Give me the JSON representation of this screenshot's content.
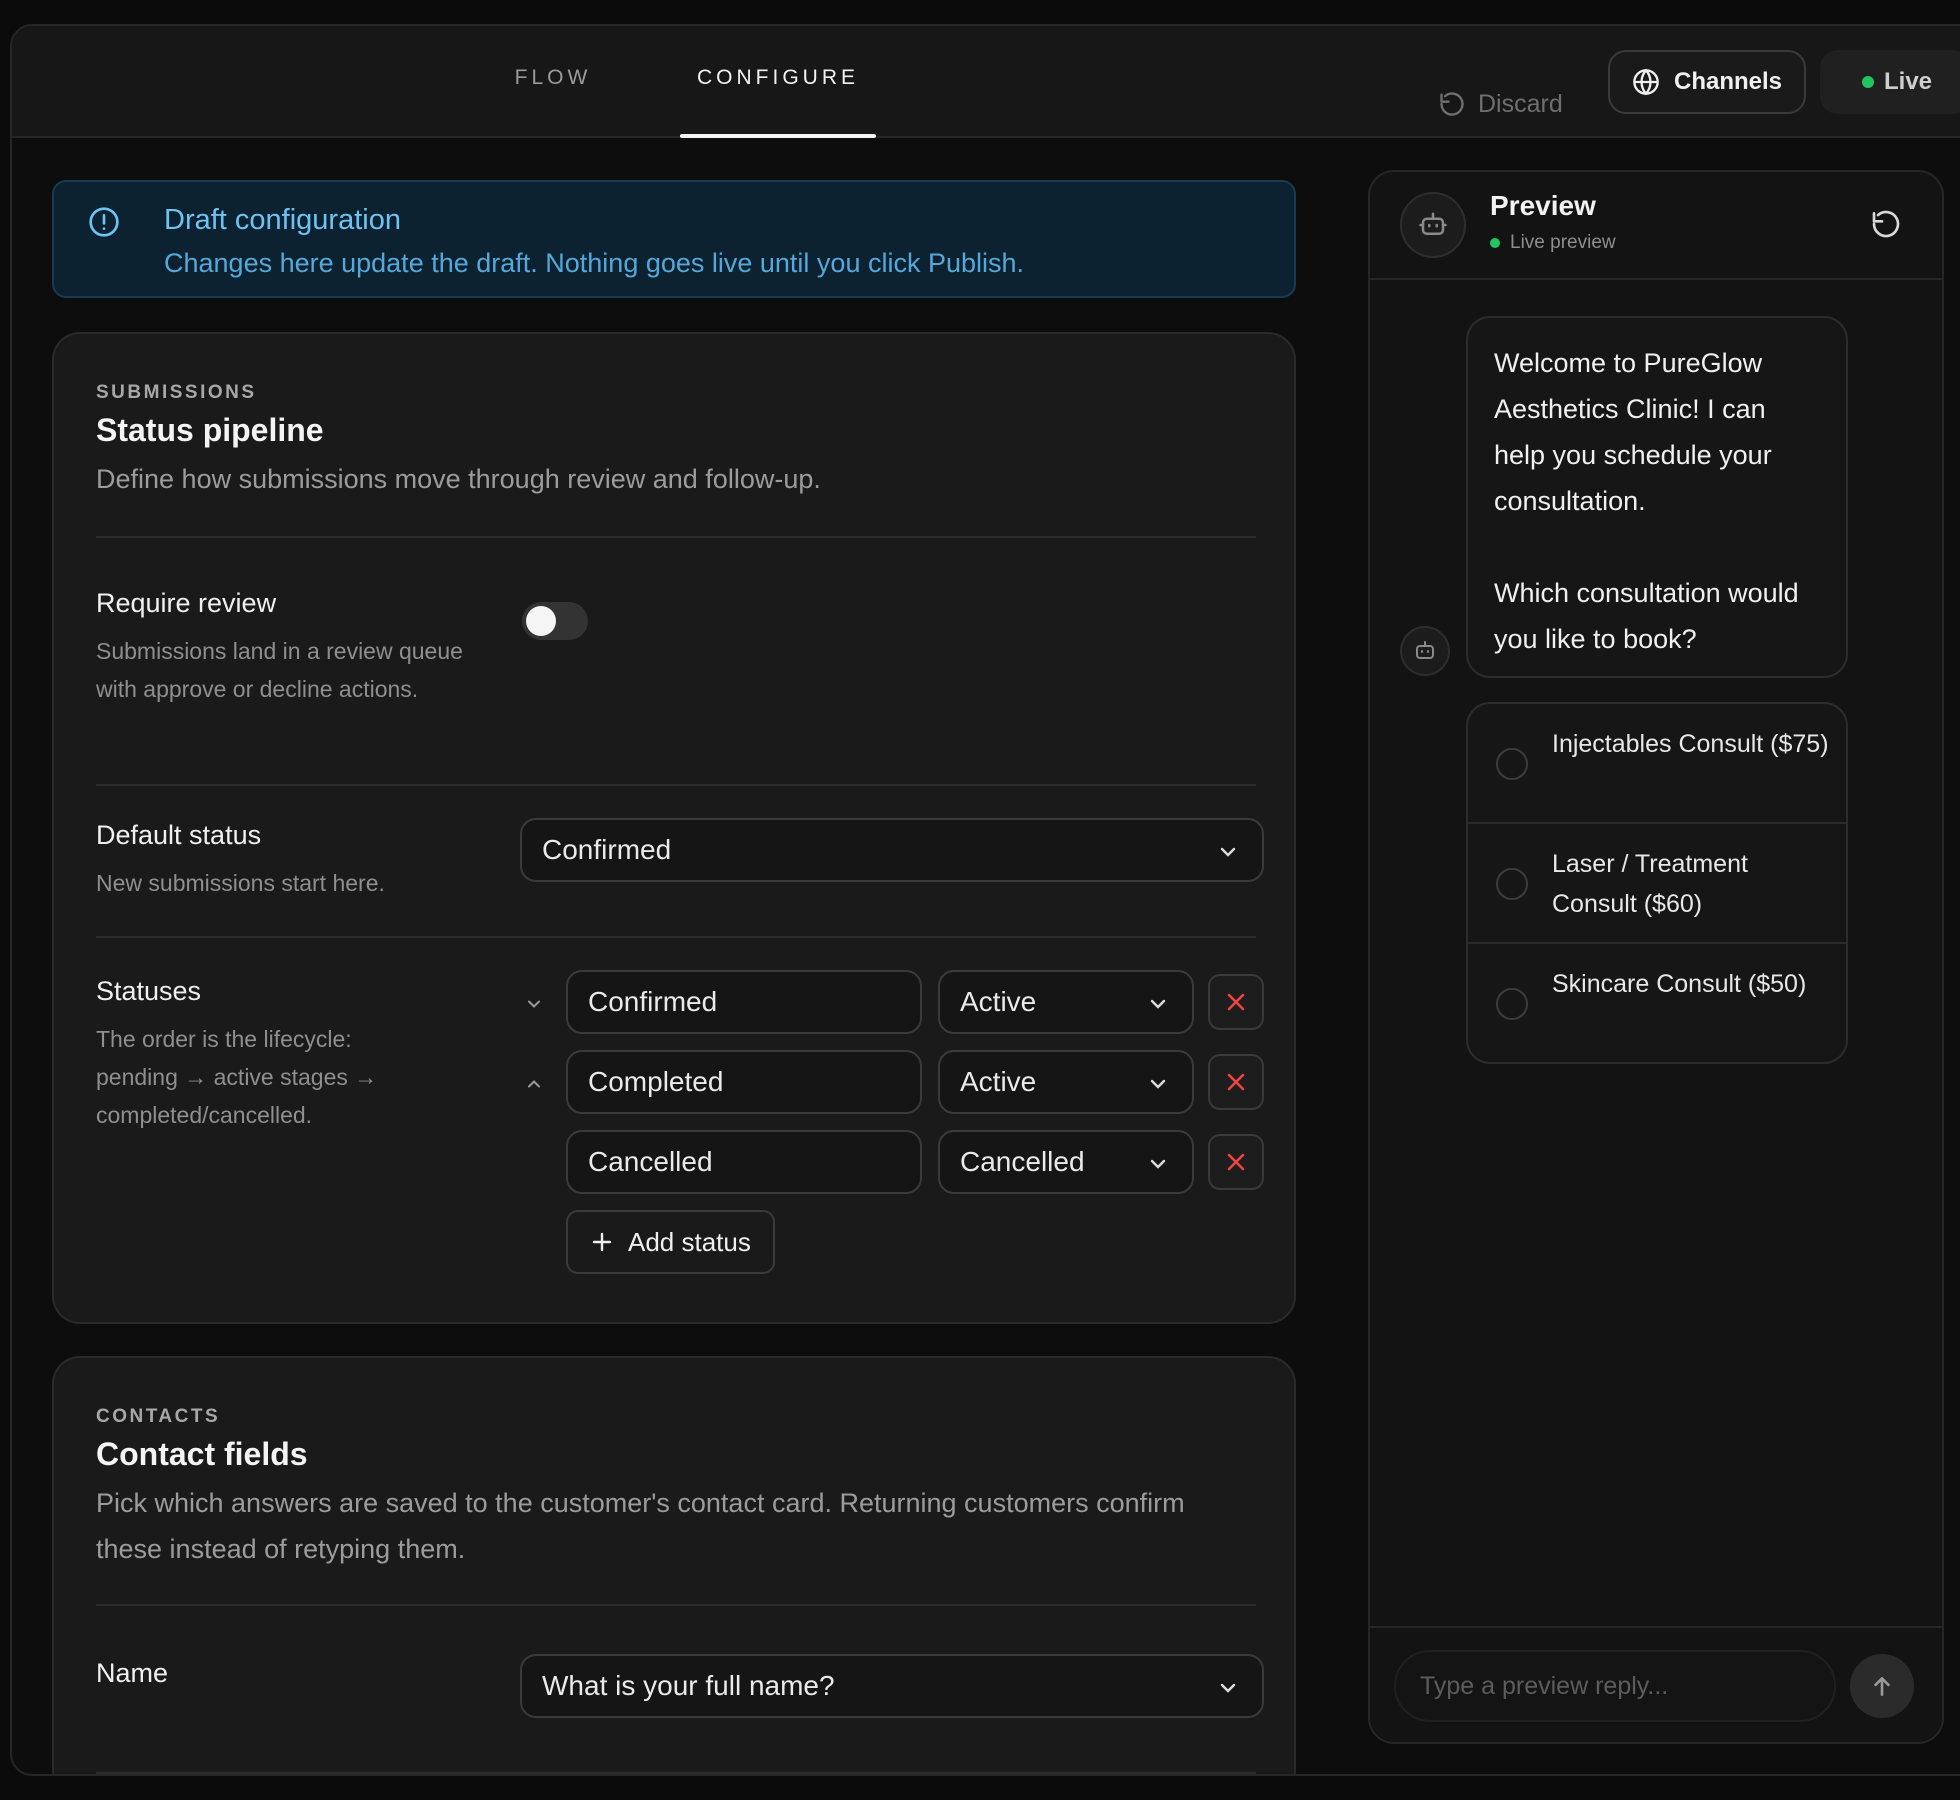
{
  "topbar": {
    "tabs": [
      {
        "label": "FLOW",
        "active": false
      },
      {
        "label": "CONFIGURE",
        "active": true
      }
    ],
    "discard_label": "Discard",
    "channels_label": "Channels",
    "live_label": "Live"
  },
  "alert": {
    "title": "Draft configuration",
    "message": "Changes here update the draft. Nothing goes live until you click Publish."
  },
  "submissions": {
    "eyebrow": "SUBMISSIONS",
    "title": "Status pipeline",
    "description": "Define how submissions move through review and follow-up.",
    "require_review": {
      "label": "Require review",
      "help": "Submissions land in a review queue with approve or decline actions.",
      "enabled": false
    },
    "default_status": {
      "label": "Default status",
      "help": "New submissions start here.",
      "value": "Confirmed"
    },
    "statuses": {
      "label": "Statuses",
      "help": "The order is the lifecycle: pending → active stages → completed/cancelled.",
      "items": [
        {
          "name": "Confirmed",
          "type": "Active"
        },
        {
          "name": "Completed",
          "type": "Active"
        },
        {
          "name": "Cancelled",
          "type": "Cancelled"
        }
      ],
      "add_label": "Add status"
    }
  },
  "contacts": {
    "eyebrow": "CONTACTS",
    "title": "Contact fields",
    "description": "Pick which answers are saved to the customer's contact card. Returning customers confirm these instead of retyping them.",
    "name_field": {
      "label": "Name",
      "value": "What is your full name?"
    }
  },
  "preview": {
    "title": "Preview",
    "subtitle": "Live preview",
    "message": "Welcome to PureGlow Aesthetics Clinic! I can help you schedule your consultation.\n\nWhich consultation would you like to book?",
    "options": [
      "Injectables Consult ($75)",
      "Laser / Treatment Consult ($60)",
      "Skincare Consult ($50)"
    ],
    "input_placeholder": "Type a preview reply..."
  },
  "colors": {
    "accent_blue": "#6ec3f2",
    "live_green": "#22c55e",
    "danger_red": "#ef4444"
  }
}
